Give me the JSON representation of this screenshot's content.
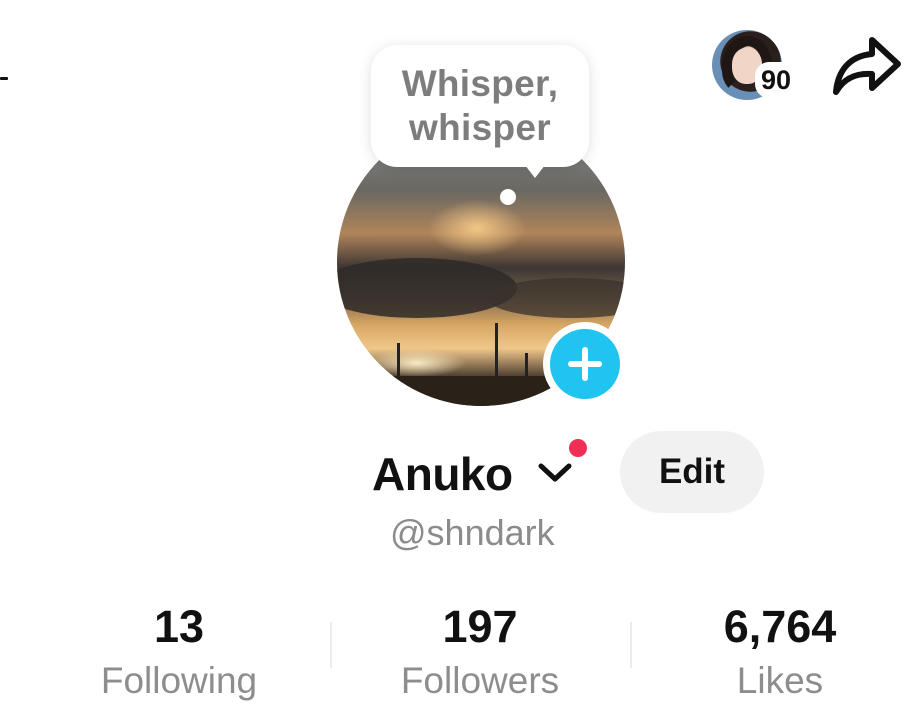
{
  "header": {
    "story_count": "90",
    "icons": [
      "left-edge-icon",
      "story-avatar",
      "share-icon"
    ]
  },
  "profile": {
    "bubble_text": "Whisper,\nwhisper",
    "name": "Anuko",
    "handle": "@shndark",
    "edit_label": "Edit",
    "icons": [
      "profile-photo",
      "add-icon",
      "chevron-down-icon",
      "notification-dot"
    ]
  },
  "stats": [
    {
      "value": "13",
      "label": "Following"
    },
    {
      "value": "197",
      "label": "Followers"
    },
    {
      "value": "6,764",
      "label": "Likes"
    }
  ],
  "colors": {
    "accent_add": "#20c4f0",
    "notification": "#f02f55",
    "muted_text": "#8d8d8d",
    "edit_bg": "#f1f1f2"
  }
}
